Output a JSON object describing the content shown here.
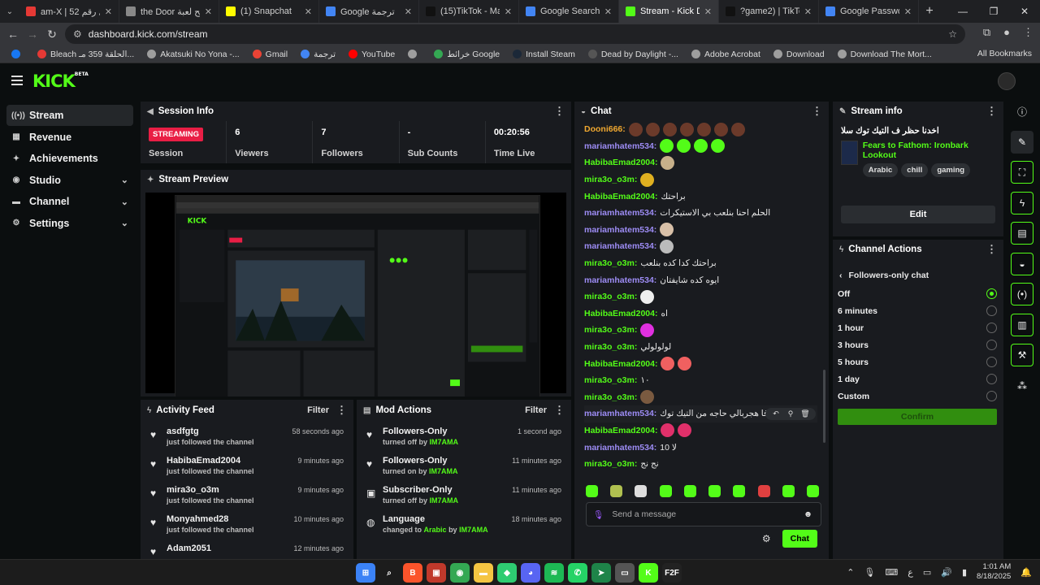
{
  "browser": {
    "tabs": [
      {
        "title": "am-X | الفصل رقم 52",
        "color": "#e53935",
        "active": false
      },
      {
        "title": "the Door توضيح لعبة",
        "color": "#888888",
        "active": false
      },
      {
        "title": "(1) Snapchat",
        "color": "#fffc00",
        "active": false
      },
      {
        "title": "Google ترجمة",
        "color": "#4285f4",
        "active": false
      },
      {
        "title": "(15)TikTok - Make Yo",
        "color": "#111111",
        "active": false
      },
      {
        "title": "Google Search",
        "color": "#4285f4",
        "active": false
      },
      {
        "title": "Stream - Kick Dashb",
        "color": "#53fc18",
        "active": true
      },
      {
        "title": "?game2) | TikTok(22)",
        "color": "#111111",
        "active": false
      },
      {
        "title": "Google Password Ma",
        "color": "#4285f4",
        "active": false
      }
    ],
    "url": "dashboard.kick.com/stream",
    "bookmarks": [
      {
        "label": "",
        "color": "#1877f2"
      },
      {
        "label": "Bleach الحلقة 359 مـ...",
        "color": "#e53935"
      },
      {
        "label": "Akatsuki No Yona -...",
        "color": "#9e9e9e"
      },
      {
        "label": "Gmail",
        "color": "#ea4335"
      },
      {
        "label": "ترجمة",
        "color": "#4285f4"
      },
      {
        "label": "YouTube",
        "color": "#ff0000"
      },
      {
        "label": "",
        "color": "#9e9e9e"
      },
      {
        "label": "خرائط Google",
        "color": "#34a853"
      },
      {
        "label": "Install Steam",
        "color": "#1b2838"
      },
      {
        "label": "Dead by Daylight -...",
        "color": "#555555"
      },
      {
        "label": "Adobe Acrobat",
        "color": "#9e9e9e"
      },
      {
        "label": "Download",
        "color": "#9e9e9e"
      },
      {
        "label": "Download The Mort...",
        "color": "#9e9e9e"
      }
    ],
    "all_bookmarks": "All Bookmarks"
  },
  "app": {
    "logo": "KICK",
    "logo_sup": "BETA",
    "nav": [
      {
        "label": "Stream",
        "icon": "broadcast-icon",
        "glyph": "((•))",
        "active": true,
        "chevron": false
      },
      {
        "label": "Revenue",
        "icon": "revenue-icon",
        "glyph": "▦",
        "active": false,
        "chevron": false
      },
      {
        "label": "Achievements",
        "icon": "achievements-icon",
        "glyph": "✦",
        "active": false,
        "chevron": false
      },
      {
        "label": "Studio",
        "icon": "studio-icon",
        "glyph": "◉",
        "active": false,
        "chevron": true
      },
      {
        "label": "Channel",
        "icon": "channel-icon",
        "glyph": "▬",
        "active": false,
        "chevron": true
      },
      {
        "label": "Settings",
        "icon": "settings-icon",
        "glyph": "⚙",
        "active": false,
        "chevron": true
      }
    ]
  },
  "session": {
    "title": "Session Info",
    "status": "STREAMING",
    "stats": [
      {
        "value": "",
        "label": "Session"
      },
      {
        "value": "6",
        "label": "Viewers"
      },
      {
        "value": "7",
        "label": "Followers"
      },
      {
        "value": "-",
        "label": "Sub Counts"
      },
      {
        "value": "00:20:56",
        "label": "Time Live"
      }
    ]
  },
  "preview": {
    "title": "Stream Preview"
  },
  "activity": {
    "title": "Activity Feed",
    "filter": "Filter",
    "items": [
      {
        "name": "asdfgtg",
        "sub": "just followed the channel",
        "time": "58 seconds ago"
      },
      {
        "name": "HabibaEmad2004",
        "sub": "just followed the channel",
        "time": "9 minutes ago"
      },
      {
        "name": "mira3o_o3m",
        "sub": "just followed the channel",
        "time": "9 minutes ago"
      },
      {
        "name": "Monyahmed28",
        "sub": "just followed the channel",
        "time": "10 minutes ago"
      },
      {
        "name": "Adam2051",
        "sub": "",
        "time": "12 minutes ago"
      }
    ]
  },
  "modactions": {
    "title": "Mod Actions",
    "filter": "Filter",
    "items": [
      {
        "icon": "heart-icon",
        "glyph": "♥",
        "name": "Followers-Only",
        "pre": "turned off by",
        "who": "IM7AMA",
        "time": "1 second ago"
      },
      {
        "icon": "heart-icon",
        "glyph": "♥",
        "name": "Followers-Only",
        "pre": "turned on by",
        "who": "IM7AMA",
        "time": "11 minutes ago"
      },
      {
        "icon": "gift-icon",
        "glyph": "▣",
        "name": "Subscriber-Only",
        "pre": "turned off by",
        "who": "IM7AMA",
        "time": "11 minutes ago"
      },
      {
        "icon": "globe-icon",
        "glyph": "◍",
        "name": "Language",
        "pre": "changed to",
        "who": "Arabic",
        "by": "by",
        "who2": "IM7AMA",
        "time": "18 minutes ago"
      }
    ]
  },
  "chat": {
    "title": "Chat",
    "messages": [
      {
        "user": "Dooni666:",
        "color": "#f0a830",
        "text": "",
        "emotes": [
          "#6b3a2a",
          "#6b3a2a",
          "#6b3a2a",
          "#6b3a2a",
          "#6b3a2a",
          "#6b3a2a",
          "#6b3a2a"
        ]
      },
      {
        "user": "mariamhatem534:",
        "color": "#9d8cf5",
        "text": "",
        "emotes": [
          "#53fc18",
          "#53fc18",
          "#53fc18",
          "#53fc18"
        ]
      },
      {
        "user": "HabibaEmad2004:",
        "color": "#53fc18",
        "text": "",
        "emotes": [
          "#c7b08a"
        ]
      },
      {
        "user": "mira3o_o3m:",
        "color": "#53fc18",
        "text": "",
        "emotes": [
          "#e0b020"
        ]
      },
      {
        "user": "HabibaEmad2004:",
        "color": "#53fc18",
        "text": "براحتك",
        "emotes": []
      },
      {
        "user": "mariamhatem534:",
        "color": "#9d8cf5",
        "text": "الحلم احنا بنلعب بي الاستيكرات",
        "emotes": []
      },
      {
        "user": "mariamhatem534:",
        "color": "#9d8cf5",
        "text": "",
        "emotes": [
          "#d8c0a8"
        ]
      },
      {
        "user": "mariamhatem534:",
        "color": "#9d8cf5",
        "text": "",
        "emotes": [
          "#bbbbbb"
        ]
      },
      {
        "user": "mira3o_o3m:",
        "color": "#53fc18",
        "text": "براحتك كدا كده بنلعب",
        "emotes": []
      },
      {
        "user": "mariamhatem534:",
        "color": "#9d8cf5",
        "text": "ايوه كده شايفتان",
        "emotes": []
      },
      {
        "user": "mira3o_o3m:",
        "color": "#53fc18",
        "text": "",
        "emotes": [
          "#eeeeee"
        ]
      },
      {
        "user": "HabibaEmad2004:",
        "color": "#53fc18",
        "text": "اه",
        "emotes": []
      },
      {
        "user": "mira3o_o3m:",
        "color": "#53fc18",
        "text": "",
        "emotes": [
          "#e030e0"
        ]
      },
      {
        "user": "mira3o_o3m:",
        "color": "#53fc18",
        "text": "لولولولي",
        "emotes": []
      },
      {
        "user": "HabibaEmad2004:",
        "color": "#53fc18",
        "text": "",
        "emotes": [
          "#f06060",
          "#f06060"
        ]
      },
      {
        "user": "mira3o_o3m:",
        "color": "#53fc18",
        "text": "١٠",
        "emotes": []
      },
      {
        "user": "mira3o_o3m:",
        "color": "#53fc18",
        "text": "",
        "emotes": [
          "#7a5a40"
        ]
      },
      {
        "user": "mariamhatem534:",
        "color": "#9d8cf5",
        "text": "فا هجربالي حاجه من التيك توك",
        "emotes": [],
        "highlight": true
      },
      {
        "user": "HabibaEmad2004:",
        "color": "#53fc18",
        "text": "",
        "emotes": [
          "#e0306a",
          "#e0306a"
        ]
      },
      {
        "user": "mariamhatem534:",
        "color": "#9d8cf5",
        "text": "لا 10",
        "emotes": []
      },
      {
        "user": "mira3o_o3m:",
        "color": "#53fc18",
        "text": "نج نج",
        "emotes": []
      }
    ],
    "msg_tools": [
      {
        "name": "reply-icon",
        "glyph": "↶"
      },
      {
        "name": "pin-icon",
        "glyph": "⚲"
      },
      {
        "name": "delete-icon",
        "glyph": "🗑"
      }
    ],
    "emote_bar": [
      "#53fc18",
      "#b0c050",
      "#dddddd",
      "#53fc18",
      "#53fc18",
      "#53fc18",
      "#53fc18",
      "#e04040",
      "#53fc18",
      "#53fc18"
    ],
    "placeholder": "Send a message",
    "send": "Chat"
  },
  "streaminfo": {
    "title": "Stream info",
    "stream_title": "اخدنا حظر ف التيك توك سلا",
    "category": "Fears to Fathom: Ironbark Lookout",
    "tags": [
      "Arabic",
      "chill",
      "gaming"
    ],
    "edit": "Edit"
  },
  "channelactions": {
    "title": "Channel Actions",
    "back": "Followers-only chat",
    "options": [
      {
        "label": "Off",
        "selected": true
      },
      {
        "label": "6 minutes",
        "selected": false
      },
      {
        "label": "1 hour",
        "selected": false
      },
      {
        "label": "3 hours",
        "selected": false
      },
      {
        "label": "5 hours",
        "selected": false
      },
      {
        "label": "1 day",
        "selected": false
      },
      {
        "label": "Custom",
        "selected": false
      }
    ],
    "confirm": "Confirm"
  },
  "rail": [
    {
      "name": "info-icon",
      "glyph": "ⓘ",
      "style": ""
    },
    {
      "name": "pencil-icon",
      "glyph": "✎",
      "style": "dark"
    },
    {
      "name": "fullscreen-icon",
      "glyph": "⛶",
      "style": "boxed"
    },
    {
      "name": "lightning-icon",
      "glyph": "ϟ",
      "style": "boxed"
    },
    {
      "name": "document-icon",
      "glyph": "▤",
      "style": "boxed"
    },
    {
      "name": "chat-bubble-icon",
      "glyph": "◒",
      "style": "boxed"
    },
    {
      "name": "broadcast-icon",
      "glyph": "(•)",
      "style": "boxed"
    },
    {
      "name": "layers-icon",
      "glyph": "▥",
      "style": "boxed"
    },
    {
      "name": "wrench-icon",
      "glyph": "⚒",
      "style": "boxed"
    },
    {
      "name": "nodes-icon",
      "glyph": "⁂",
      "style": ""
    }
  ],
  "taskbar": {
    "apps": [
      {
        "name": "windows-start-icon",
        "glyph": "⊞",
        "color": "#3b82f6"
      },
      {
        "name": "search-icon",
        "glyph": "⌕",
        "color": "#1c1c1c"
      },
      {
        "name": "brave-icon",
        "glyph": "B",
        "color": "#fb542b"
      },
      {
        "name": "app-icon",
        "glyph": "▣",
        "color": "#c0392b"
      },
      {
        "name": "chrome-icon",
        "glyph": "◉",
        "color": "#34a853"
      },
      {
        "name": "folder-icon",
        "glyph": "▬",
        "color": "#f5c542"
      },
      {
        "name": "app-green-icon",
        "glyph": "◆",
        "color": "#2ecc71"
      },
      {
        "name": "discord-icon",
        "glyph": "◕",
        "color": "#5865f2"
      },
      {
        "name": "spotify-icon",
        "glyph": "≋",
        "color": "#1db954"
      },
      {
        "name": "whatsapp-icon",
        "glyph": "✆",
        "color": "#25d366"
      },
      {
        "name": "app-send-icon",
        "glyph": "➤",
        "color": "#1e8449"
      },
      {
        "name": "monitor-icon",
        "glyph": "▭",
        "color": "#555555"
      },
      {
        "name": "kick-icon",
        "glyph": "K",
        "color": "#53fc18"
      },
      {
        "name": "f2f-icon",
        "glyph": "F2F",
        "color": "#222222"
      }
    ],
    "lang": "ع",
    "time": "1:01 AM",
    "date": "8/18/2025"
  }
}
